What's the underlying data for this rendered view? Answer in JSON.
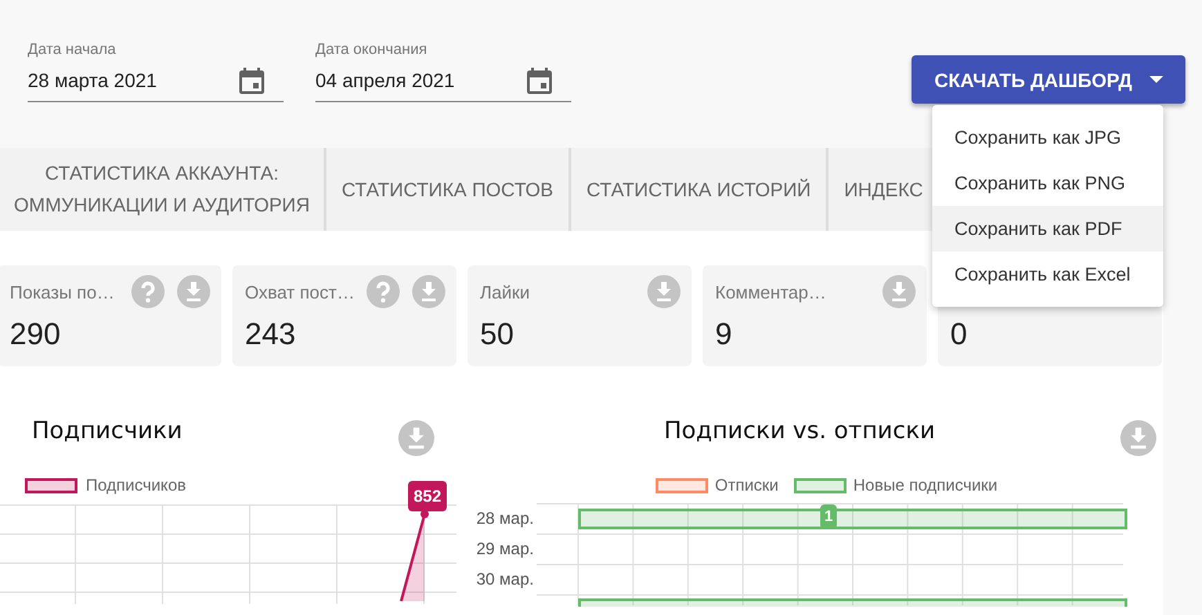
{
  "date_fields": [
    {
      "label": "Дата начала",
      "value": "28 марта 2021"
    },
    {
      "label": "Дата окончания",
      "value": "04 апреля 2021"
    }
  ],
  "download_button": {
    "label": "СКАЧАТЬ ДАШБОРД",
    "expanded": true
  },
  "download_menu": [
    {
      "label": "Сохранить как JPG",
      "highlighted": false
    },
    {
      "label": "Сохранить как PNG",
      "highlighted": false
    },
    {
      "label": "Сохранить как PDF",
      "highlighted": true
    },
    {
      "label": "Сохранить как Excel",
      "highlighted": false
    }
  ],
  "tabs": [
    {
      "lines": [
        "СТАТИСТИКА АККАУНТА:",
        "ОММУНИКАЦИИ И АУДИТОРИЯ"
      ]
    },
    {
      "lines": [
        "СТАТИСТИКА ПОСТОВ"
      ]
    },
    {
      "lines": [
        "СТАТИСТИКА ИСТОРИЙ"
      ]
    },
    {
      "lines": [
        "ИНДЕКС"
      ]
    }
  ],
  "stat_cards": [
    {
      "label": "Показы по…",
      "value": "290",
      "help": true,
      "download": true
    },
    {
      "label": "Охват пост…",
      "value": "243",
      "help": true,
      "download": true
    },
    {
      "label": "Лайки",
      "value": "50",
      "help": false,
      "download": true
    },
    {
      "label": "Комментар…",
      "value": "9",
      "help": false,
      "download": true
    },
    {
      "value": "0"
    }
  ],
  "charts": [
    {
      "kind": "line",
      "title": "Подписчики",
      "legend": [
        {
          "label": "Подписчиков",
          "color": "#c2185b"
        }
      ],
      "point_label": "852"
    },
    {
      "kind": "bar",
      "title": "Подписки vs. отписки",
      "legend": [
        {
          "label": "Отписки",
          "color": "#ff8a65"
        },
        {
          "label": "Новые подписчики",
          "color": "#66bb6a"
        }
      ],
      "row_labels": [
        "28 мар.",
        "29 мар.",
        "30 мар."
      ],
      "bar_label": "1"
    }
  ]
}
